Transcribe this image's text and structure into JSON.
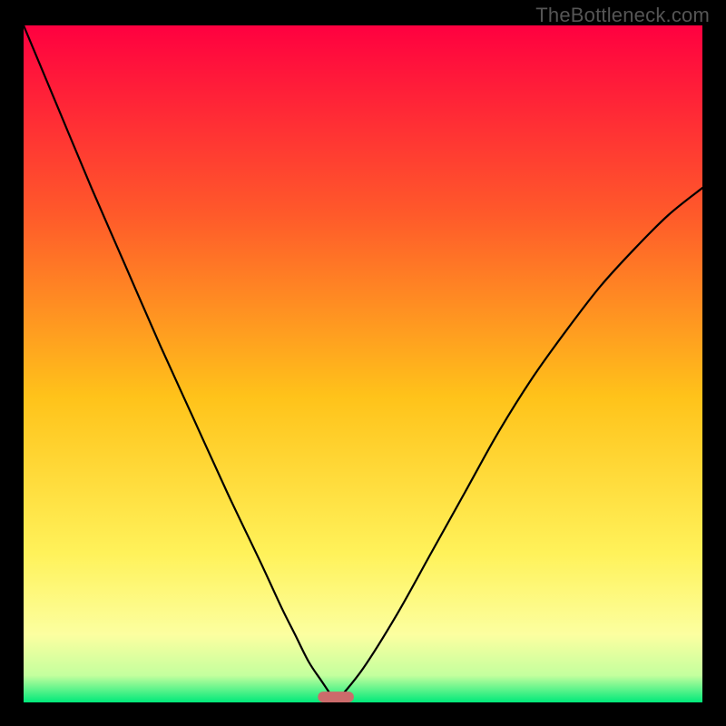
{
  "watermark": "TheBottleneck.com",
  "colors": {
    "gradient_stops": [
      {
        "offset": "0%",
        "color": "#ff0040"
      },
      {
        "offset": "28%",
        "color": "#ff5a2a"
      },
      {
        "offset": "55%",
        "color": "#ffc31a"
      },
      {
        "offset": "78%",
        "color": "#fff25a"
      },
      {
        "offset": "90%",
        "color": "#fcffa0"
      },
      {
        "offset": "96%",
        "color": "#c4ff9e"
      },
      {
        "offset": "100%",
        "color": "#00e97a"
      }
    ],
    "curve_stroke": "#000000",
    "marker_fill": "#cc6b6b",
    "frame_bg": "#000000"
  },
  "chart_data": {
    "type": "line",
    "title": "",
    "xlabel": "",
    "ylabel": "",
    "xlim": [
      0,
      100
    ],
    "ylim": [
      0,
      100
    ],
    "x": [
      0,
      5,
      10,
      15,
      20,
      25,
      30,
      35,
      38,
      40,
      42,
      44,
      46,
      50,
      55,
      60,
      65,
      70,
      75,
      80,
      85,
      90,
      95,
      100
    ],
    "series": [
      {
        "name": "left_branch",
        "values": [
          100,
          88,
          76,
          64.5,
          53,
          42,
          31,
          20.5,
          14,
          10,
          6,
          3,
          0,
          null,
          null,
          null,
          null,
          null,
          null,
          null,
          null,
          null,
          null,
          null
        ]
      },
      {
        "name": "right_branch",
        "values": [
          null,
          null,
          null,
          null,
          null,
          null,
          null,
          null,
          null,
          null,
          null,
          null,
          0,
          5,
          13,
          22,
          31,
          40,
          48,
          55,
          61.5,
          67,
          72,
          76
        ]
      }
    ],
    "marker": {
      "x_center": 46,
      "y": 0.8,
      "width_x_units": 5.3,
      "height_y_units": 1.6
    }
  }
}
